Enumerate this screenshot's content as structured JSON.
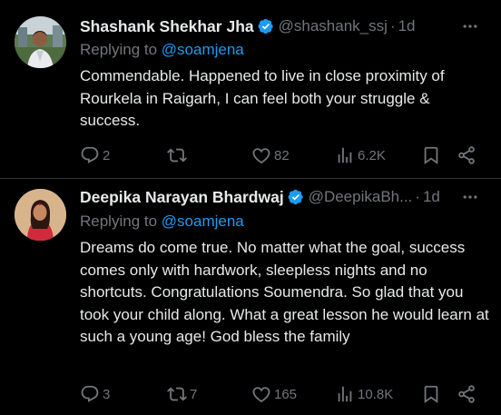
{
  "tweets": [
    {
      "name": "Shashank Shekhar Jha",
      "handle": "@shashank_ssj",
      "dot": "·",
      "time": "1d",
      "replying_prefix": "Replying to ",
      "replying_to": "@soamjena",
      "text": "Commendable. Happened to live in close proximity of Rourkela in Raigarh, I can feel both your struggle & success.",
      "stats": {
        "replies": "2",
        "reposts": "",
        "likes": "82",
        "views": "6.2K"
      }
    },
    {
      "name": "Deepika Narayan Bhardwaj",
      "handle": "@DeepikaBh...",
      "dot": "·",
      "time": "1d",
      "replying_prefix": "Replying to ",
      "replying_to": "@soamjena",
      "text": "Dreams do come true. No matter what the goal, success comes only with hardwork, sleepless nights and no shortcuts. Congratulations Soumendra. So glad that you took your child along. What a great lesson he would learn at such a young age! God bless the family",
      "stats": {
        "replies": "3",
        "reposts": "7",
        "likes": "165",
        "views": "10.8K"
      }
    }
  ],
  "icons": [
    "avatar",
    "verified-badge-icon",
    "more-icon",
    "reply-icon",
    "repost-icon",
    "like-icon",
    "views-icon",
    "bookmark-icon",
    "share-icon"
  ],
  "colors": {
    "background": "#000000",
    "text": "#e7e9ea",
    "muted": "#71767b",
    "link": "#1d9bf0",
    "divider": "#2f3336"
  }
}
